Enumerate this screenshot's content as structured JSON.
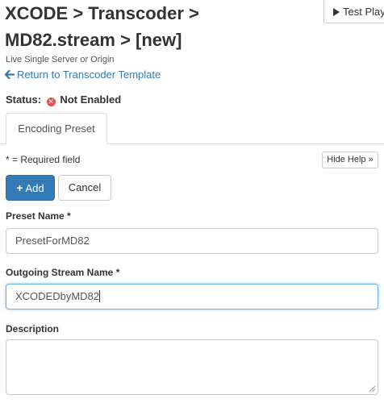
{
  "header": {
    "title_line1": "XCODE > Transcoder >",
    "title_line2": "MD82.stream > [new]",
    "subtitle": "Live Single Server or Origin",
    "return_link": "Return to Transcoder Template",
    "test_player_label": "Test Player"
  },
  "status": {
    "label": "Status:",
    "value": "Not Enabled",
    "color": "#d9534f"
  },
  "tabs": [
    {
      "label": "Encoding Preset",
      "active": true
    }
  ],
  "form": {
    "required_note": "* = Required field",
    "hide_help_label": "Hide Help »",
    "add_label": "Add",
    "cancel_label": "Cancel",
    "preset_name": {
      "label": "Preset Name *",
      "value": "PresetForMD82"
    },
    "outgoing_stream_name": {
      "label": "Outgoing Stream Name *",
      "value": "XCODEDbyMD82"
    },
    "description": {
      "label": "Description",
      "value": ""
    }
  },
  "colors": {
    "primary": "#337ab7",
    "link": "#337ab7",
    "status_error": "#d9534f",
    "focus_border": "#66afe9"
  },
  "icons": {
    "test_player": "play-icon",
    "return": "arrow-left-icon",
    "status": "x-circle-icon",
    "add": "plus-icon",
    "resize": "resize-handle-icon"
  }
}
